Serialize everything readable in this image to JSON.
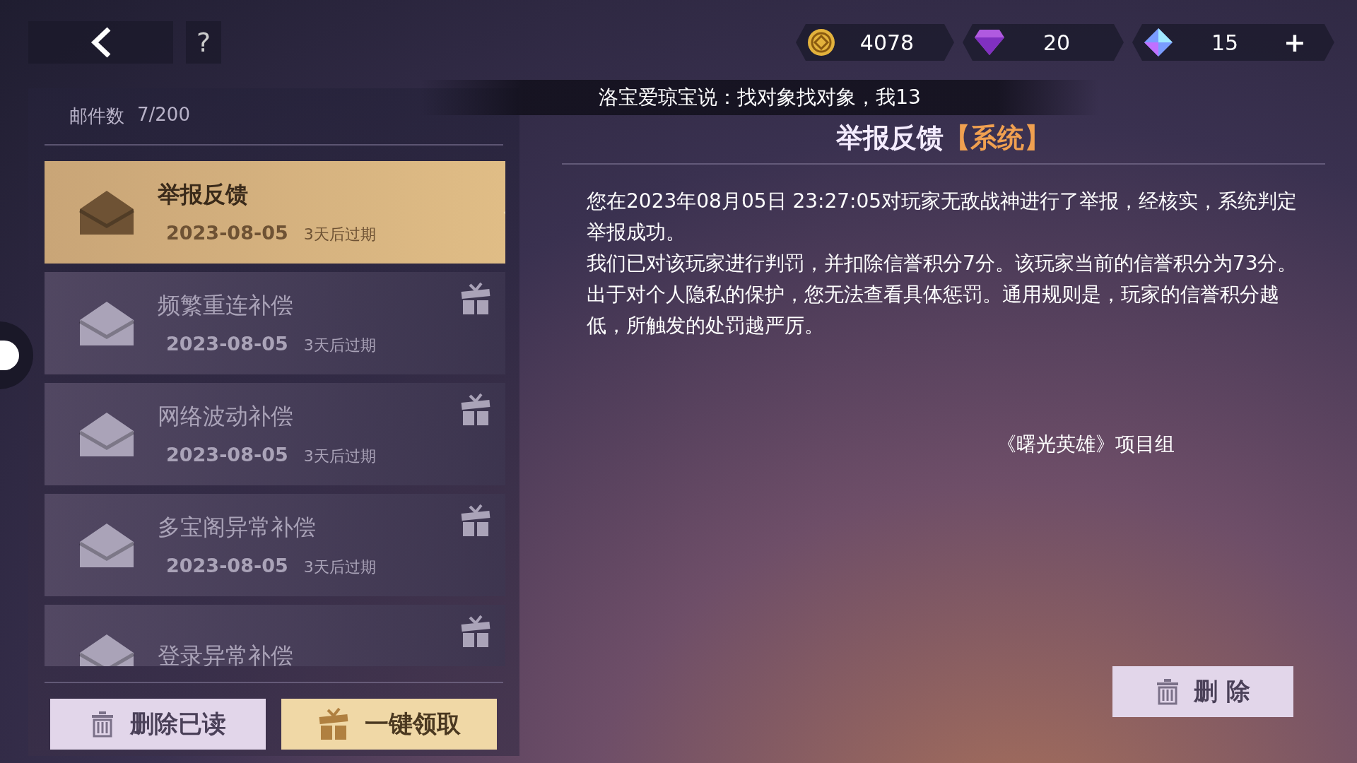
{
  "top_bar": {
    "currencies": [
      {
        "kind": "coin",
        "amount": "4078"
      },
      {
        "kind": "gem",
        "amount": "20"
      },
      {
        "kind": "crystal",
        "amount": "15"
      }
    ],
    "add_button": "+",
    "help_button": "?"
  },
  "broadcast": "洛宝爱琼宝说：找对象找对象，我13",
  "mailbox": {
    "count_label": "邮件数",
    "count": "7/200",
    "mails": [
      {
        "title": "举报反馈",
        "date": "2023-08-05",
        "expiry": "3天后过期",
        "selected": true,
        "has_gift": false
      },
      {
        "title": "频繁重连补偿",
        "date": "2023-08-05",
        "expiry": "3天后过期",
        "selected": false,
        "has_gift": true
      },
      {
        "title": "网络波动补偿",
        "date": "2023-08-05",
        "expiry": "3天后过期",
        "selected": false,
        "has_gift": true
      },
      {
        "title": "多宝阁异常补偿",
        "date": "2023-08-05",
        "expiry": "3天后过期",
        "selected": false,
        "has_gift": true
      },
      {
        "title": "登录异常补偿",
        "selected": false,
        "has_gift": true
      }
    ],
    "buttons": [
      {
        "kind": "delete",
        "label": "删除已读"
      },
      {
        "kind": "claim",
        "label": "一键领取"
      }
    ]
  },
  "reader": {
    "title": "举报反馈",
    "tag": "【系统】",
    "paragraphs": [
      "您在2023年08月05日 23:27:05对玩家无敌战神进行了举报，经核实，系统判定举报成功。",
      "我们已对该玩家进行判罚，并扣除信誉积分7分。该玩家当前的信誉积分为73分。",
      "出于对个人隐私的保护，您无法查看具体惩罚。通用规则是，玩家的信誉积分越低，所触发的处罚越严厉。"
    ],
    "signature": "《曙光英雄》项目组",
    "delete_button": "删 除"
  }
}
